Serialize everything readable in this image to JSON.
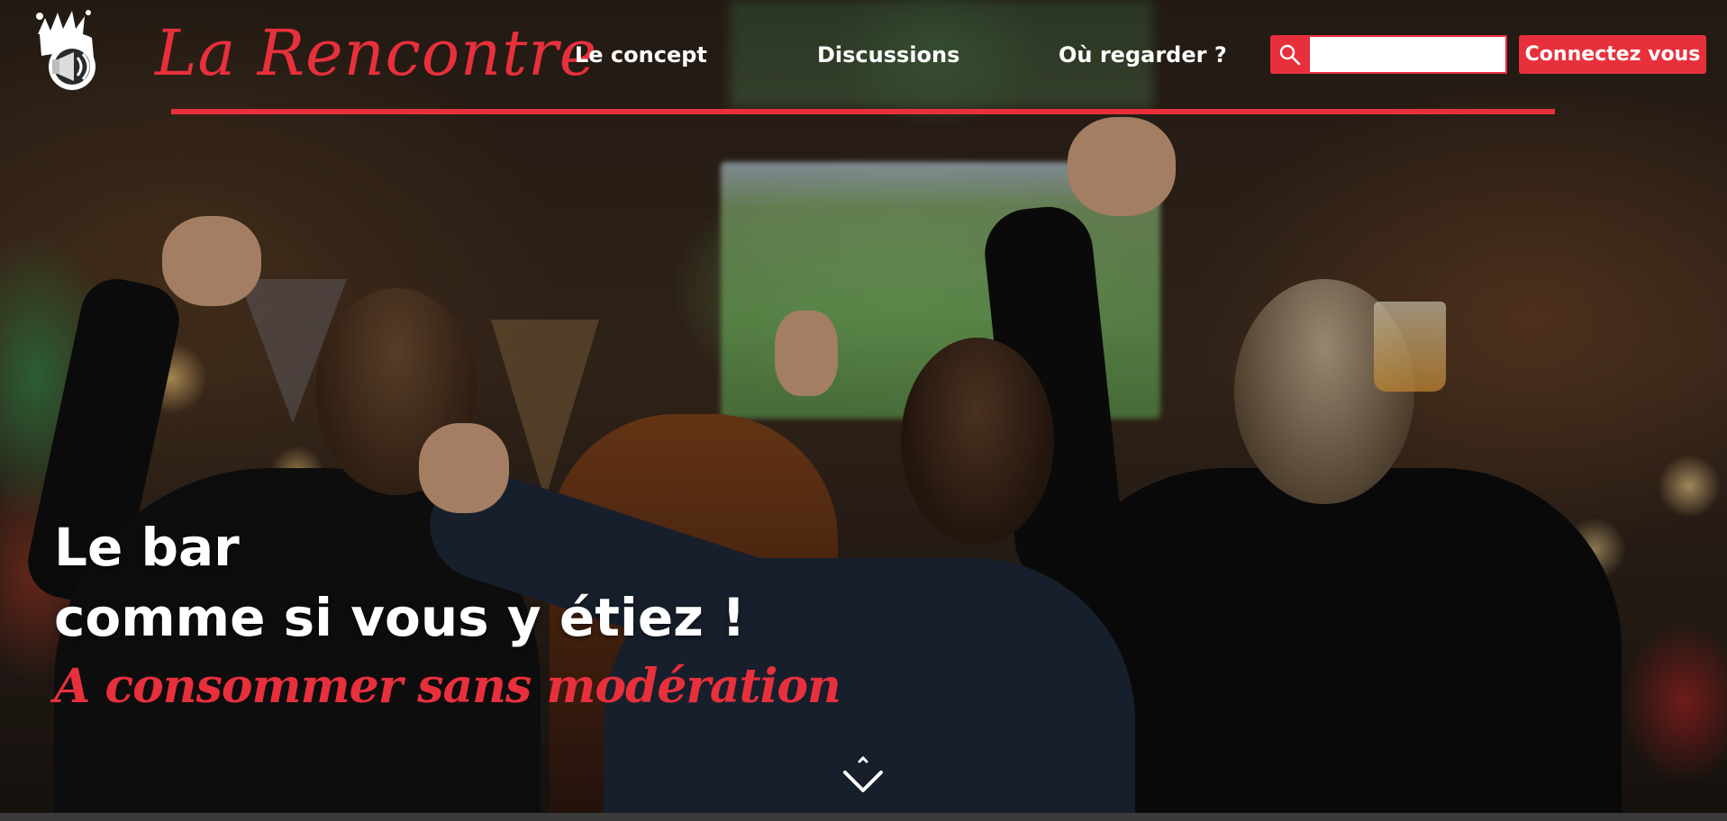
{
  "brand": {
    "name": "La Rencontre"
  },
  "nav": {
    "items": [
      {
        "label": "Le concept"
      },
      {
        "label": "Discussions"
      },
      {
        "label": "Où regarder ?"
      }
    ]
  },
  "search": {
    "value": "",
    "placeholder": "",
    "icon": "search-icon"
  },
  "login": {
    "label": "Connectez vous"
  },
  "hero": {
    "line1": "Le bar",
    "line2": "comme si vous y étiez !",
    "tagline": "A consommer sans modération",
    "scroll_icon": "chevron-down-icon"
  },
  "colors": {
    "accent": "#e8303c",
    "text": "#ffffff",
    "bottom_bar": "#3b3b3b"
  }
}
